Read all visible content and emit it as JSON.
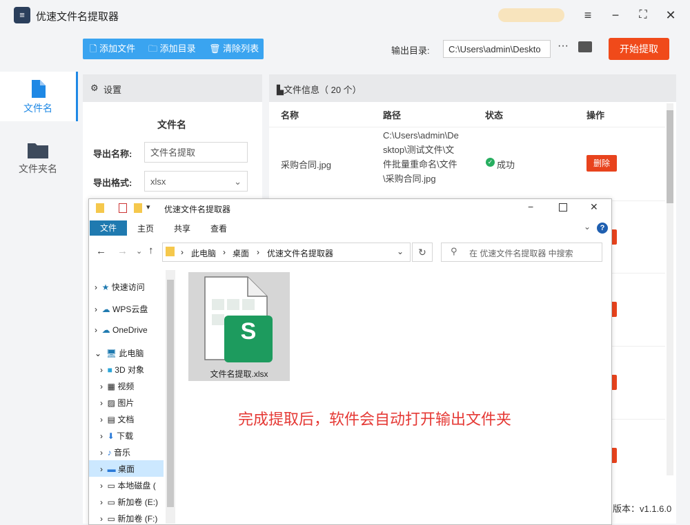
{
  "window": {
    "title": "优速文件名提取器"
  },
  "sidebar": {
    "items": [
      {
        "label": "文件名"
      },
      {
        "label": "文件夹名"
      }
    ]
  },
  "toolbar": {
    "add_file": "添加文件",
    "add_dir": "添加目录",
    "clear_list": "清除列表",
    "output_label": "输出目录:",
    "output_value": "C:\\Users\\admin\\Deskto",
    "more": "···",
    "start": "开始提取"
  },
  "settings": {
    "title": "设置",
    "section": "文件名",
    "export_name_label": "导出名称:",
    "export_name_value": "文件名提取",
    "export_format_label": "导出格式:",
    "export_format_value": "xlsx"
  },
  "file_info": {
    "title": "文件信息（ 20 个）",
    "columns": [
      "名称",
      "路径",
      "状态",
      "操作"
    ],
    "rows": [
      {
        "name": "采购合同.jpg",
        "path": "C:\\Users\\admin\\Desktop\\测试文件\\文件批量重命名\\文件\\采购合同.jpg",
        "status": "成功",
        "action": "删除"
      }
    ]
  },
  "footer": {
    "version": "版本：v1.1.6.0"
  },
  "explorer": {
    "title": "优速文件名提取器",
    "ribbon": [
      "文件",
      "主页",
      "共享",
      "查看"
    ],
    "breadcrumb": [
      "此电脑",
      "桌面",
      "优速文件名提取器"
    ],
    "search_placeholder": "在 优速文件名提取器 中搜索",
    "nav": [
      "快速访问",
      "WPS云盘",
      "OneDrive",
      "此电脑",
      "3D 对象",
      "视频",
      "图片",
      "文档",
      "下载",
      "音乐",
      "桌面",
      "本地磁盘 (",
      "新加卷 (E:)",
      "新加卷 (F:)"
    ],
    "file": {
      "name": "文件名提取.xlsx",
      "badge": "S"
    }
  },
  "annotation": "完成提取后，软件会自动打开输出文件夹",
  "colors": {
    "accent": "#3aa4f0",
    "start": "#f04a1a",
    "delete": "#e8431d",
    "annotation": "#e53935"
  }
}
